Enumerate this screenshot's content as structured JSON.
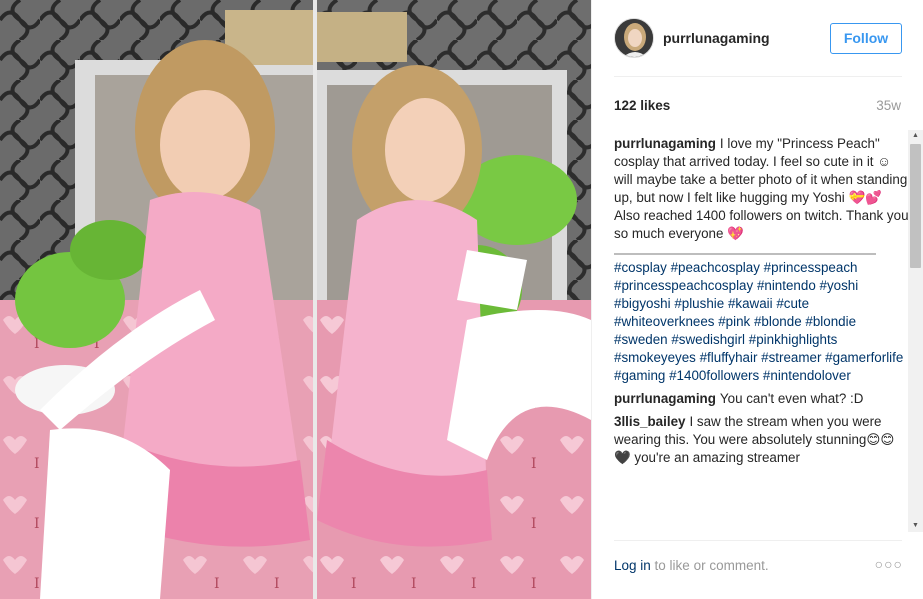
{
  "post": {
    "username": "purrlunagaming",
    "follow_label": "Follow",
    "likes": "122 likes",
    "age": "35w"
  },
  "caption": {
    "author": "purrlunagaming",
    "text": "I love my \"Princess Peach\" cosplay that arrived today. I feel so cute in it ☺ will maybe take a better photo of it when standing up, but now I felt like hugging my Yoshi 💝💕 Also reached 1400 followers on twitch. Thank you so much everyone 💖",
    "hashtags": [
      "#cosplay",
      "#peachcosplay",
      "#princesspeach",
      "#princesspeachcosplay",
      "#nintendo",
      "#yoshi",
      "#bigyoshi",
      "#plushie",
      "#kawaii",
      "#cute",
      "#whiteoverknees",
      "#pink",
      "#blonde",
      "#blondie",
      "#sweden",
      "#swedishgirl",
      "#pinkhighlights",
      "#smokeyeyes",
      "#fluffyhair",
      "#streamer",
      "#gamerforlife",
      "#gaming",
      "#1400followers",
      "#nintendolover"
    ]
  },
  "comments": [
    {
      "author": "purrlunagaming",
      "text": "You can't even what? :D"
    },
    {
      "author": "3llis_bailey",
      "text": "I saw the stream when you were wearing this. You were absolutely stunning😊😊🖤 you're an amazing streamer"
    }
  ],
  "footer": {
    "login_link": "Log in",
    "login_text": " to like or comment.",
    "more": "○○○"
  },
  "colors": {
    "link": "#003569",
    "follow": "#3897f0",
    "muted": "#999999"
  }
}
